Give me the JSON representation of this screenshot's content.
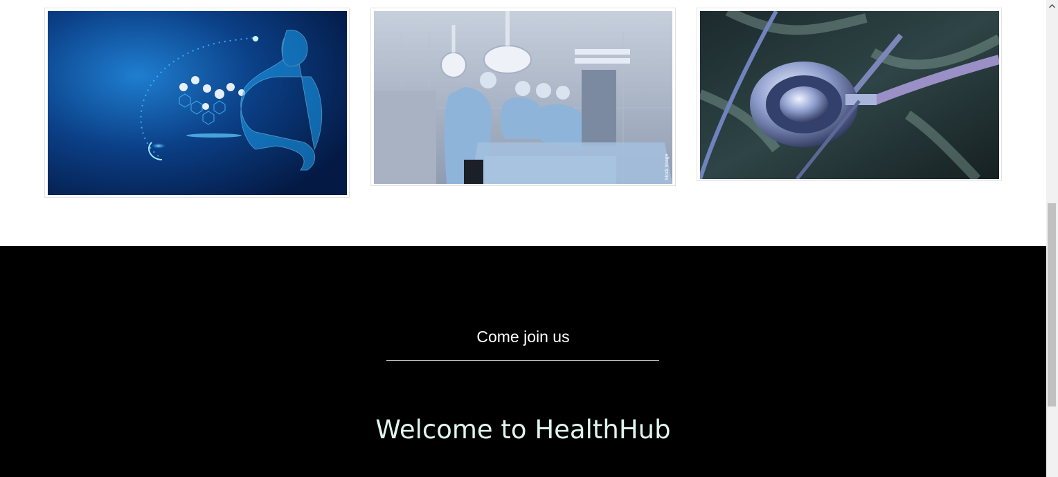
{
  "gallery": {
    "images": [
      {
        "subject": "digital-doctor-with-medical-icons",
        "accent": "#1e8ee6"
      },
      {
        "subject": "surgeons-in-operating-room",
        "accent": "#9fb0c6",
        "caption": "Stock image"
      },
      {
        "subject": "stethoscope-on-xray",
        "accent": "#8b94c8"
      }
    ]
  },
  "footer": {
    "join_text": "Come join us",
    "welcome_text": "Welcome to HealthHub",
    "background": "#000000",
    "welcome_color": "#dff5ee"
  },
  "scrollbar": {
    "up_arrow_icon": "chevron-up-icon"
  }
}
